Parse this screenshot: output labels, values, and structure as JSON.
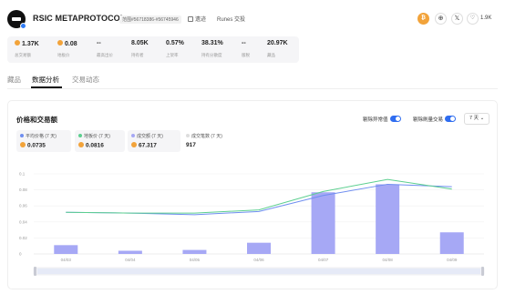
{
  "header": {
    "title": "RSIC METAPROTOCOL",
    "range": "范围#56718386-#56745946",
    "links": [
      {
        "label": "遗迹",
        "icon": "relic-icon"
      },
      {
        "label": "Runes 交投",
        "icon": ""
      }
    ],
    "icons": [
      "btc-icon",
      "globe-icon",
      "x-icon"
    ],
    "icon_glyphs": [
      "₿",
      "⊕",
      "𝕏"
    ],
    "likes": "1.9K"
  },
  "stats": [
    {
      "value": "1.37K",
      "label": "总交易额",
      "coin": true
    },
    {
      "value": "0.08",
      "label": "地板价",
      "coin": true
    },
    {
      "value": "--",
      "label": "最高出价",
      "coin": false
    },
    {
      "value": "8.05K",
      "label": "持有者",
      "coin": false
    },
    {
      "value": "0.57%",
      "label": "上架率",
      "coin": false
    },
    {
      "value": "38.31%",
      "label": "持有分散度",
      "coin": false
    },
    {
      "value": "--",
      "label": "版税",
      "coin": false
    },
    {
      "value": "20.97K",
      "label": "藏品",
      "coin": false
    }
  ],
  "tabs": [
    {
      "label": "藏品",
      "active": false
    },
    {
      "label": "数据分析",
      "active": true
    },
    {
      "label": "交易动态",
      "active": false
    }
  ],
  "card": {
    "title": "价格和交易额",
    "toggles": [
      {
        "label": "剔除异常值",
        "on": true
      },
      {
        "label": "剔除刷量交易",
        "on": true
      }
    ],
    "range_select": "7 天"
  },
  "metrics": [
    {
      "label": "平均价格 (7 天)",
      "value": "0.0735",
      "coin": true,
      "dot_color": "#6f8ef0"
    },
    {
      "label": "地板价 (7 天)",
      "value": "0.0816",
      "coin": true,
      "dot_color": "#5ccf8f"
    },
    {
      "label": "成交额 (7 天)",
      "value": "67.317",
      "coin": true,
      "dot_color": "#a6a8f5"
    },
    {
      "label": "成交笔数 (7 天)",
      "value": "917",
      "coin": false,
      "dot_color": "#dddddd"
    }
  ],
  "colors": {
    "accent": "#2f6df0",
    "bitcoin": "#f2a33a",
    "bar": "#a6a8f5",
    "avg_line": "#6f8ef0",
    "floor_line": "#5ccf8f"
  },
  "chart_data": {
    "type": "bar",
    "categories": [
      "04/03",
      "04/04",
      "04/05",
      "04/06",
      "04/07",
      "04/08",
      "04/09"
    ],
    "yticks": [
      "0.1",
      "0.08",
      "0.06",
      "0.04",
      "0.02",
      "0"
    ],
    "ylim": [
      0,
      0.1
    ],
    "series": [
      {
        "name": "成交额",
        "type": "bar",
        "values": [
          0.011,
          0.004,
          0.005,
          0.014,
          0.077,
          0.087,
          0.027
        ]
      },
      {
        "name": "平均价格",
        "type": "line",
        "values": [
          0.052,
          0.051,
          0.049,
          0.053,
          0.073,
          0.087,
          0.084
        ]
      },
      {
        "name": "地板价",
        "type": "line",
        "values": [
          0.052,
          0.051,
          0.051,
          0.055,
          0.078,
          0.093,
          0.081
        ]
      }
    ],
    "grid": true
  }
}
